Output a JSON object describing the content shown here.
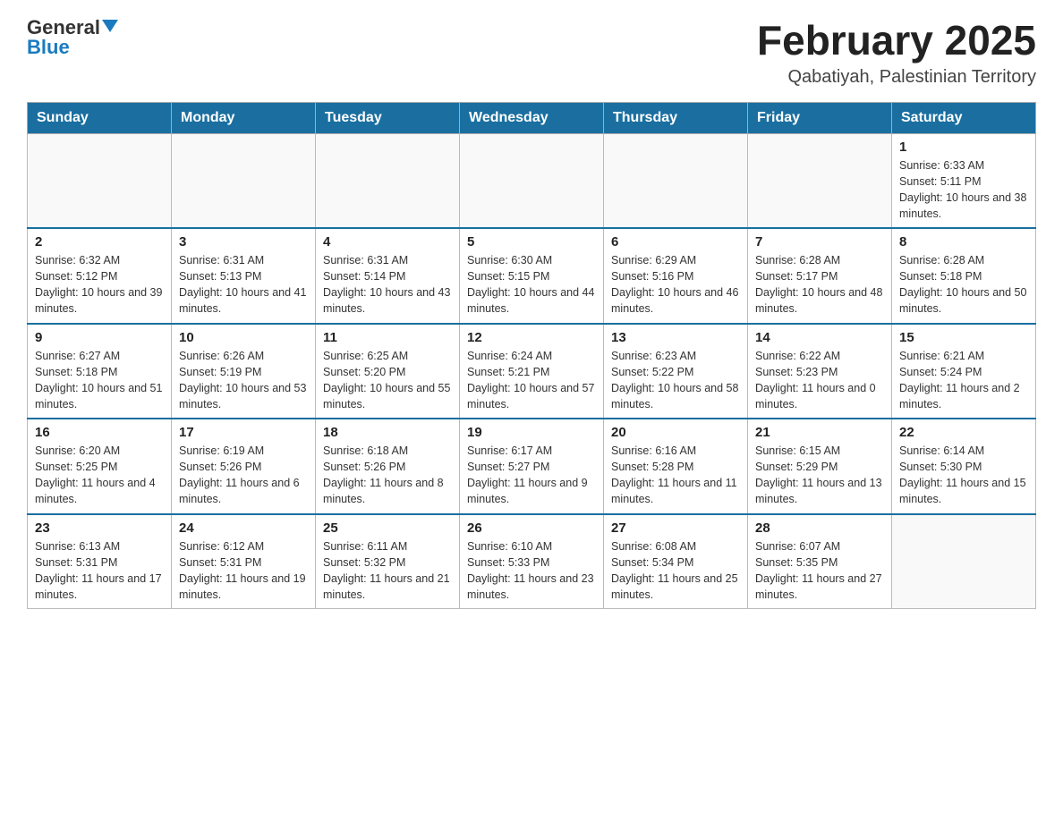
{
  "header": {
    "logo_general": "General",
    "logo_blue": "Blue",
    "month_title": "February 2025",
    "location": "Qabatiyah, Palestinian Territory"
  },
  "days_of_week": [
    "Sunday",
    "Monday",
    "Tuesday",
    "Wednesday",
    "Thursday",
    "Friday",
    "Saturday"
  ],
  "weeks": [
    [
      {
        "day": "",
        "info": ""
      },
      {
        "day": "",
        "info": ""
      },
      {
        "day": "",
        "info": ""
      },
      {
        "day": "",
        "info": ""
      },
      {
        "day": "",
        "info": ""
      },
      {
        "day": "",
        "info": ""
      },
      {
        "day": "1",
        "info": "Sunrise: 6:33 AM\nSunset: 5:11 PM\nDaylight: 10 hours and 38 minutes."
      }
    ],
    [
      {
        "day": "2",
        "info": "Sunrise: 6:32 AM\nSunset: 5:12 PM\nDaylight: 10 hours and 39 minutes."
      },
      {
        "day": "3",
        "info": "Sunrise: 6:31 AM\nSunset: 5:13 PM\nDaylight: 10 hours and 41 minutes."
      },
      {
        "day": "4",
        "info": "Sunrise: 6:31 AM\nSunset: 5:14 PM\nDaylight: 10 hours and 43 minutes."
      },
      {
        "day": "5",
        "info": "Sunrise: 6:30 AM\nSunset: 5:15 PM\nDaylight: 10 hours and 44 minutes."
      },
      {
        "day": "6",
        "info": "Sunrise: 6:29 AM\nSunset: 5:16 PM\nDaylight: 10 hours and 46 minutes."
      },
      {
        "day": "7",
        "info": "Sunrise: 6:28 AM\nSunset: 5:17 PM\nDaylight: 10 hours and 48 minutes."
      },
      {
        "day": "8",
        "info": "Sunrise: 6:28 AM\nSunset: 5:18 PM\nDaylight: 10 hours and 50 minutes."
      }
    ],
    [
      {
        "day": "9",
        "info": "Sunrise: 6:27 AM\nSunset: 5:18 PM\nDaylight: 10 hours and 51 minutes."
      },
      {
        "day": "10",
        "info": "Sunrise: 6:26 AM\nSunset: 5:19 PM\nDaylight: 10 hours and 53 minutes."
      },
      {
        "day": "11",
        "info": "Sunrise: 6:25 AM\nSunset: 5:20 PM\nDaylight: 10 hours and 55 minutes."
      },
      {
        "day": "12",
        "info": "Sunrise: 6:24 AM\nSunset: 5:21 PM\nDaylight: 10 hours and 57 minutes."
      },
      {
        "day": "13",
        "info": "Sunrise: 6:23 AM\nSunset: 5:22 PM\nDaylight: 10 hours and 58 minutes."
      },
      {
        "day": "14",
        "info": "Sunrise: 6:22 AM\nSunset: 5:23 PM\nDaylight: 11 hours and 0 minutes."
      },
      {
        "day": "15",
        "info": "Sunrise: 6:21 AM\nSunset: 5:24 PM\nDaylight: 11 hours and 2 minutes."
      }
    ],
    [
      {
        "day": "16",
        "info": "Sunrise: 6:20 AM\nSunset: 5:25 PM\nDaylight: 11 hours and 4 minutes."
      },
      {
        "day": "17",
        "info": "Sunrise: 6:19 AM\nSunset: 5:26 PM\nDaylight: 11 hours and 6 minutes."
      },
      {
        "day": "18",
        "info": "Sunrise: 6:18 AM\nSunset: 5:26 PM\nDaylight: 11 hours and 8 minutes."
      },
      {
        "day": "19",
        "info": "Sunrise: 6:17 AM\nSunset: 5:27 PM\nDaylight: 11 hours and 9 minutes."
      },
      {
        "day": "20",
        "info": "Sunrise: 6:16 AM\nSunset: 5:28 PM\nDaylight: 11 hours and 11 minutes."
      },
      {
        "day": "21",
        "info": "Sunrise: 6:15 AM\nSunset: 5:29 PM\nDaylight: 11 hours and 13 minutes."
      },
      {
        "day": "22",
        "info": "Sunrise: 6:14 AM\nSunset: 5:30 PM\nDaylight: 11 hours and 15 minutes."
      }
    ],
    [
      {
        "day": "23",
        "info": "Sunrise: 6:13 AM\nSunset: 5:31 PM\nDaylight: 11 hours and 17 minutes."
      },
      {
        "day": "24",
        "info": "Sunrise: 6:12 AM\nSunset: 5:31 PM\nDaylight: 11 hours and 19 minutes."
      },
      {
        "day": "25",
        "info": "Sunrise: 6:11 AM\nSunset: 5:32 PM\nDaylight: 11 hours and 21 minutes."
      },
      {
        "day": "26",
        "info": "Sunrise: 6:10 AM\nSunset: 5:33 PM\nDaylight: 11 hours and 23 minutes."
      },
      {
        "day": "27",
        "info": "Sunrise: 6:08 AM\nSunset: 5:34 PM\nDaylight: 11 hours and 25 minutes."
      },
      {
        "day": "28",
        "info": "Sunrise: 6:07 AM\nSunset: 5:35 PM\nDaylight: 11 hours and 27 minutes."
      },
      {
        "day": "",
        "info": ""
      }
    ]
  ]
}
